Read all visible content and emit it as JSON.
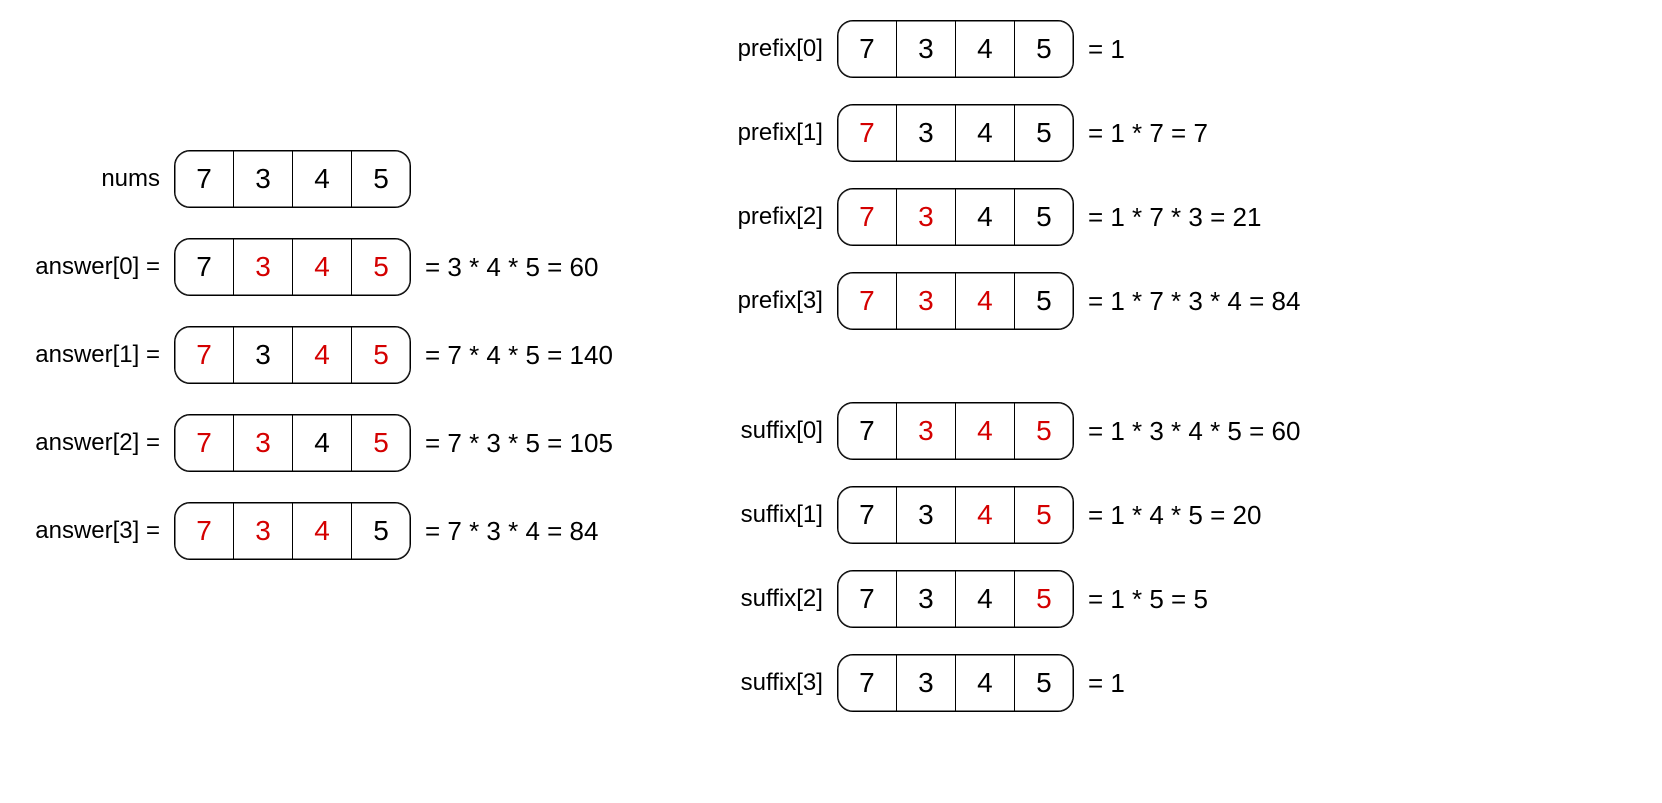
{
  "nums": [
    "7",
    "3",
    "4",
    "5"
  ],
  "left": {
    "numsLabel": "nums",
    "rows": [
      {
        "label": "answer[0] =",
        "hi": [
          1,
          2,
          3
        ],
        "formula": "= 3 * 4 * 5 = 60"
      },
      {
        "label": "answer[1] =",
        "hi": [
          0,
          2,
          3
        ],
        "formula": "= 7 * 4 * 5 = 140"
      },
      {
        "label": "answer[2] =",
        "hi": [
          0,
          1,
          3
        ],
        "formula": "= 7 * 3 * 5 = 105"
      },
      {
        "label": "answer[3] =",
        "hi": [
          0,
          1,
          2
        ],
        "formula": "= 7 * 3 * 4 = 84"
      }
    ]
  },
  "right": {
    "prefix": [
      {
        "label": "prefix[0]",
        "hi": [],
        "formula": "= 1"
      },
      {
        "label": "prefix[1]",
        "hi": [
          0
        ],
        "formula": "= 1 * 7 = 7"
      },
      {
        "label": "prefix[2]",
        "hi": [
          0,
          1
        ],
        "formula": "= 1 * 7 * 3 = 21"
      },
      {
        "label": "prefix[3]",
        "hi": [
          0,
          1,
          2
        ],
        "formula": "= 1 * 7 * 3 * 4 = 84"
      }
    ],
    "suffix": [
      {
        "label": "suffix[0]",
        "hi": [
          1,
          2,
          3
        ],
        "formula": "= 1 * 3 * 4 * 5 = 60"
      },
      {
        "label": "suffix[1]",
        "hi": [
          2,
          3
        ],
        "formula": "= 1 * 4 * 5 = 20"
      },
      {
        "label": "suffix[2]",
        "hi": [
          3
        ],
        "formula": "= 1 * 5 = 5"
      },
      {
        "label": "suffix[3]",
        "hi": [],
        "formula": "= 1"
      }
    ]
  }
}
